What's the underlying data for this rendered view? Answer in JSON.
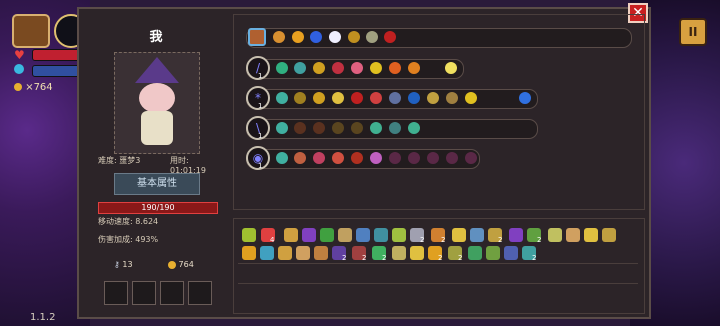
{
  "character": {
    "name": "我",
    "difficulty": "难度: 噩梦3",
    "time": "用时: 01:01:19"
  },
  "attributes": {
    "tab_label": "基本属性",
    "hp": "190/190",
    "move_speed": "移动速度: 8.624",
    "damage_bonus": "伤害加成: 493%"
  },
  "resources": {
    "keys": "13",
    "coins": "764"
  },
  "hud": {
    "coins": "×764",
    "version": "1.1.2"
  },
  "weapon_rows": [
    {
      "label": "1",
      "weapon_icon": "chest-icon"
    },
    {
      "label": "1",
      "weapon_icon": "spear-icon"
    },
    {
      "label": "1",
      "weapon_icon": "staff-icon"
    },
    {
      "label": "1",
      "weapon_icon": "sword-icon"
    },
    {
      "label": "1",
      "weapon_icon": "orb-icon"
    }
  ],
  "bag_counts": {
    "a": "4",
    "b": "2",
    "c": "2",
    "d": "2",
    "e": "2",
    "f": "2",
    "g": "2",
    "h": "2",
    "i": "2",
    "j": "2",
    "k": "2",
    "l": "2",
    "m": "2",
    "n": "2"
  },
  "colors": {
    "panel": "#2c2428",
    "accent": "#d8a040",
    "hp": "#8a1818",
    "close": "#c82020"
  }
}
